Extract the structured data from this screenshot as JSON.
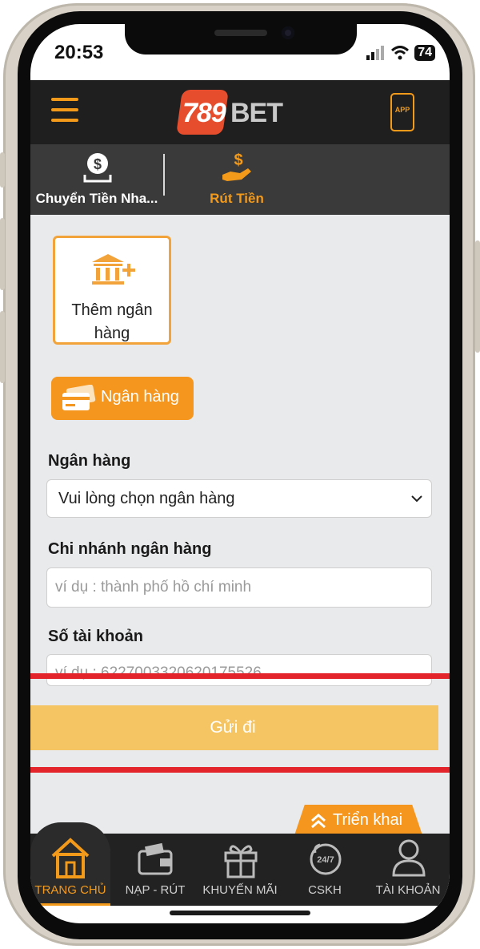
{
  "status_bar": {
    "time": "20:53",
    "battery": "74"
  },
  "header": {
    "logo_number": "789",
    "logo_text": "BET",
    "app_label": "APP"
  },
  "top_tabs": [
    {
      "label": "Chuyển Tiền Nha..."
    },
    {
      "label": "Rút Tiền"
    }
  ],
  "withdraw_form": {
    "add_bank_label": "Thêm ngân hàng",
    "bank_chip_label": "Ngân hàng",
    "bank_field_label": "Ngân hàng",
    "bank_select_value": "Vui lòng chọn ngân hàng",
    "branch_field_label": "Chi nhánh ngân hàng",
    "branch_placeholder": "ví dụ : thành phố hồ chí minh",
    "account_field_label": "Số tài khoản",
    "account_placeholder": "ví dụ : 6227003320620175526",
    "submit_label": "Gửi đi",
    "deploy_label": "Triển khai"
  },
  "bottom_nav": [
    {
      "label": "TRANG CHỦ"
    },
    {
      "label": "NẠP - RÚT"
    },
    {
      "label": "KHUYẾN MÃI"
    },
    {
      "label": "CSKH"
    },
    {
      "label": "TÀI KHOẢN"
    }
  ],
  "colors": {
    "accent": "#f39a1a",
    "highlight": "#e3252b",
    "submit": "#f6c563",
    "header_bg": "#1f1f1f"
  }
}
